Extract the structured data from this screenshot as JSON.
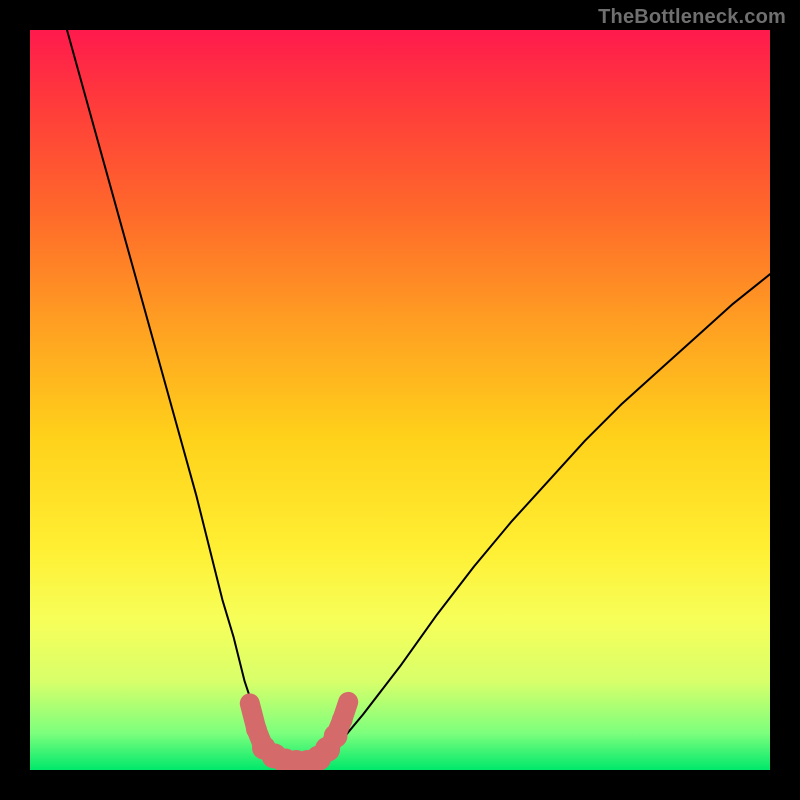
{
  "watermark": {
    "text": "TheBottleneck.com"
  },
  "chart_data": {
    "type": "line",
    "title": "",
    "xlabel": "",
    "ylabel": "",
    "xlim": [
      0,
      100
    ],
    "ylim": [
      0,
      100
    ],
    "grid": false,
    "legend": false,
    "annotations": [],
    "series": [
      {
        "name": "bottleneck-curve",
        "color": "#000000",
        "x": [
          5,
          7.5,
          10,
          12.5,
          15,
          17.5,
          20,
          22.5,
          25,
          26,
          27.5,
          29,
          30,
          31,
          32,
          33,
          34,
          35,
          36,
          37.5,
          40,
          42.5,
          45,
          50,
          55,
          60,
          65,
          70,
          75,
          80,
          85,
          90,
          95,
          100
        ],
        "values": [
          100,
          91,
          82,
          73,
          64,
          55,
          46,
          37,
          27,
          23,
          18,
          12,
          9,
          6,
          4,
          2.5,
          1.6,
          1.1,
          1.0,
          1.1,
          2.2,
          4.5,
          7.5,
          14,
          21,
          27.5,
          33.5,
          39,
          44.5,
          49.5,
          54,
          58.5,
          63,
          67
        ]
      },
      {
        "name": "highlight-band",
        "type": "marker-path",
        "color": "#d46a6a",
        "points": [
          {
            "x": 29.7,
            "y": 9.0,
            "r": 1.0
          },
          {
            "x": 30.6,
            "y": 5.5,
            "r": 1.4
          },
          {
            "x": 31.6,
            "y": 3.0,
            "r": 1.6
          },
          {
            "x": 33.0,
            "y": 1.9,
            "r": 1.7
          },
          {
            "x": 34.5,
            "y": 1.2,
            "r": 1.7
          },
          {
            "x": 36.0,
            "y": 1.0,
            "r": 1.7
          },
          {
            "x": 37.5,
            "y": 1.0,
            "r": 1.7
          },
          {
            "x": 39.0,
            "y": 1.6,
            "r": 1.7
          },
          {
            "x": 40.2,
            "y": 2.8,
            "r": 1.7
          },
          {
            "x": 41.3,
            "y": 4.6,
            "r": 1.6
          },
          {
            "x": 42.2,
            "y": 6.8,
            "r": 1.4
          },
          {
            "x": 43.0,
            "y": 9.2,
            "r": 1.1
          }
        ]
      }
    ]
  }
}
